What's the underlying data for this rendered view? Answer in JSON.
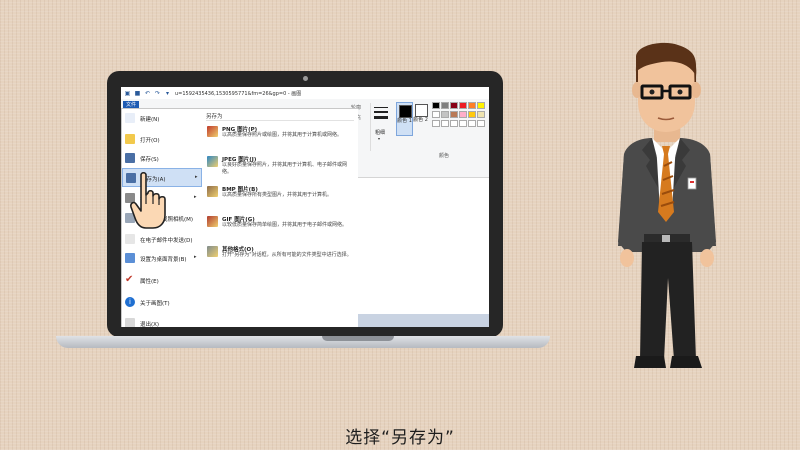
{
  "window": {
    "title": "u=1592435436,1530595771&fm=26&gp=0 - 画图",
    "file_tab": "文件"
  },
  "ribbon": {
    "outline": "轮廓",
    "fill": "填充",
    "size": "粗细",
    "color1": "颜色 1",
    "color2": "颜色 2",
    "colors_group": "颜色",
    "palette": [
      "#000000",
      "#7f7f7f",
      "#880015",
      "#ed1c24",
      "#ff7f27",
      "#fff200",
      "#ffffff",
      "#c3c3c3",
      "#b97a57",
      "#ffaec9",
      "#ffc90e",
      "#efe4b0",
      "#ffffff",
      "#ffffff",
      "#ffffff",
      "#ffffff",
      "#ffffff",
      "#ffffff"
    ]
  },
  "file_menu": {
    "items": [
      {
        "label": "新建(N)",
        "icon": "new-file-icon",
        "has_arrow": false
      },
      {
        "label": "打开(O)",
        "icon": "open-folder-icon",
        "has_arrow": false
      },
      {
        "label": "保存(S)",
        "icon": "save-disk-icon",
        "has_arrow": false
      },
      {
        "label": "另存为(A)",
        "icon": "save-as-icon",
        "has_arrow": true
      },
      {
        "label": "打印(P)",
        "icon": "printer-icon",
        "has_arrow": true
      },
      {
        "label": "从扫描仪或照相机(M)",
        "icon": "scanner-icon",
        "has_arrow": false
      },
      {
        "label": "在电子邮件中发送(D)",
        "icon": "email-icon",
        "has_arrow": false
      },
      {
        "label": "设置为桌面背景(B)",
        "icon": "desktop-background-icon",
        "has_arrow": true
      },
      {
        "label": "属性(E)",
        "icon": "properties-icon",
        "has_arrow": false
      },
      {
        "label": "关于画图(T)",
        "icon": "about-info-icon",
        "has_arrow": false
      },
      {
        "label": "退出(X)",
        "icon": "exit-icon",
        "has_arrow": false
      }
    ],
    "saveas_header": "另存为",
    "saveas_options": [
      {
        "title": "PNG 图片(P)",
        "desc": "以高质量保存照片或绘图，并将其用于计算机或网络。",
        "icon": "png-image-icon"
      },
      {
        "title": "JPEG 图片(J)",
        "desc": "以良好质量保存照片，并将其用于计算机、电子邮件或网络。",
        "icon": "jpeg-image-icon"
      },
      {
        "title": "BMP 图片(B)",
        "desc": "以高质量保存所有类型图片，并将其用于计算机。",
        "icon": "bmp-image-icon"
      },
      {
        "title": "GIF 图片(G)",
        "desc": "以较低质量保存简单绘图，并将其用于电子邮件或网络。",
        "icon": "gif-image-icon"
      },
      {
        "title": "其他格式(O)",
        "desc": "打开\"另存为\"对话框，从所有可能的文件类型中进行选择。",
        "icon": "other-formats-icon"
      }
    ]
  },
  "caption": "选择“另存为”"
}
